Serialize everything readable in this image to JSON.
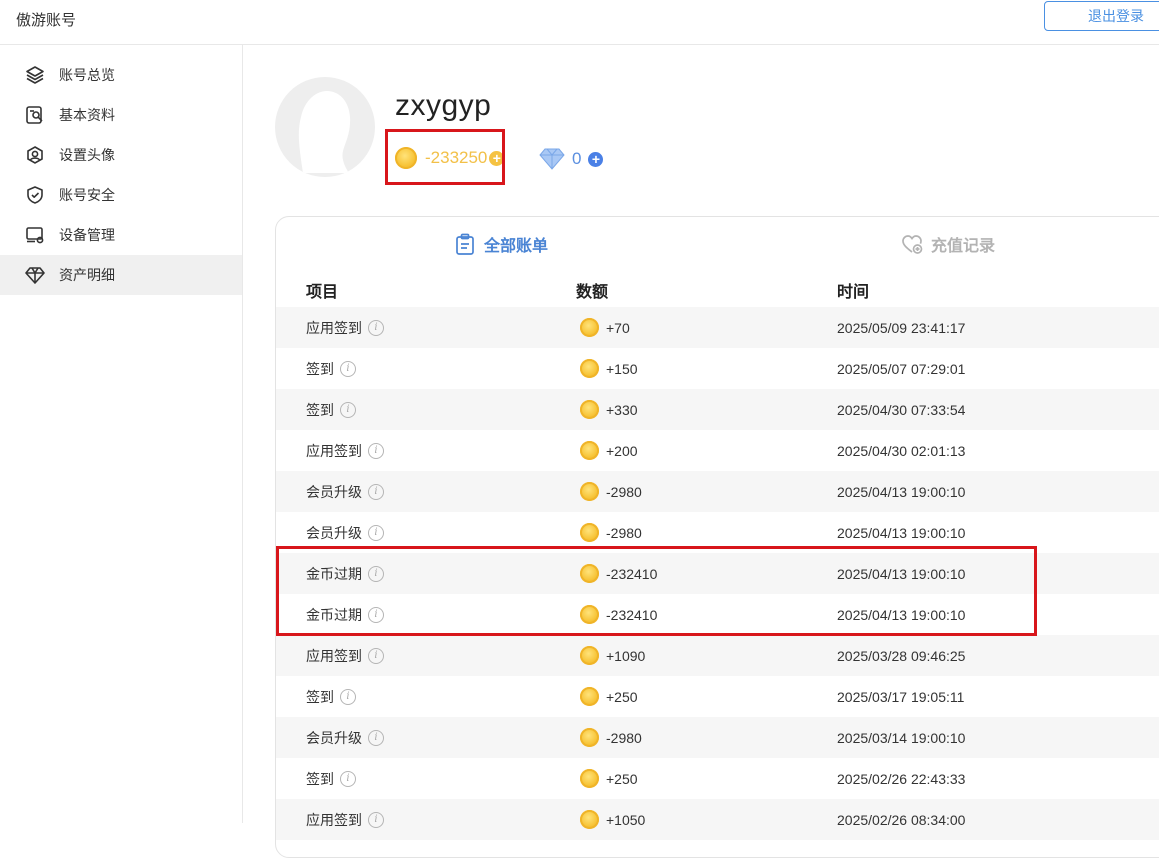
{
  "header": {
    "title": "傲游账号",
    "logout_label": "退出登录"
  },
  "sidebar": {
    "items": [
      {
        "label": "账号总览",
        "icon": "layers-icon"
      },
      {
        "label": "基本资料",
        "icon": "profile-card-icon"
      },
      {
        "label": "设置头像",
        "icon": "avatar-icon"
      },
      {
        "label": "账号安全",
        "icon": "shield-icon"
      },
      {
        "label": "设备管理",
        "icon": "device-icon"
      },
      {
        "label": "资产明细",
        "icon": "diamond-icon",
        "active": true
      }
    ]
  },
  "profile": {
    "username": "zxygyp",
    "coin_balance": "-233250",
    "diamond_balance": "0"
  },
  "tabs": [
    {
      "label": "全部账单",
      "active": true
    },
    {
      "label": "充值记录",
      "active": false
    }
  ],
  "table": {
    "headers": [
      "项目",
      "数额",
      "时间"
    ],
    "rows": [
      {
        "item": "应用签到",
        "amount": "+70",
        "time": "2025/05/09 23:41:17"
      },
      {
        "item": "签到",
        "amount": "+150",
        "time": "2025/05/07 07:29:01"
      },
      {
        "item": "签到",
        "amount": "+330",
        "time": "2025/04/30 07:33:54"
      },
      {
        "item": "应用签到",
        "amount": "+200",
        "time": "2025/04/30 02:01:13"
      },
      {
        "item": "会员升级",
        "amount": "-2980",
        "time": "2025/04/13 19:00:10"
      },
      {
        "item": "会员升级",
        "amount": "-2980",
        "time": "2025/04/13 19:00:10"
      },
      {
        "item": "金币过期",
        "amount": "-232410",
        "time": "2025/04/13 19:00:10"
      },
      {
        "item": "金币过期",
        "amount": "-232410",
        "time": "2025/04/13 19:00:10"
      },
      {
        "item": "应用签到",
        "amount": "+1090",
        "time": "2025/03/28 09:46:25"
      },
      {
        "item": "签到",
        "amount": "+250",
        "time": "2025/03/17 19:05:11"
      },
      {
        "item": "会员升级",
        "amount": "-2980",
        "time": "2025/03/14 19:00:10"
      },
      {
        "item": "签到",
        "amount": "+250",
        "time": "2025/02/26 22:43:33"
      },
      {
        "item": "应用签到",
        "amount": "+1050",
        "time": "2025/02/26 08:34:00"
      }
    ]
  },
  "colors": {
    "accent": "#4a84d4",
    "coin": "#f2c048",
    "highlight": "#d8161b"
  }
}
